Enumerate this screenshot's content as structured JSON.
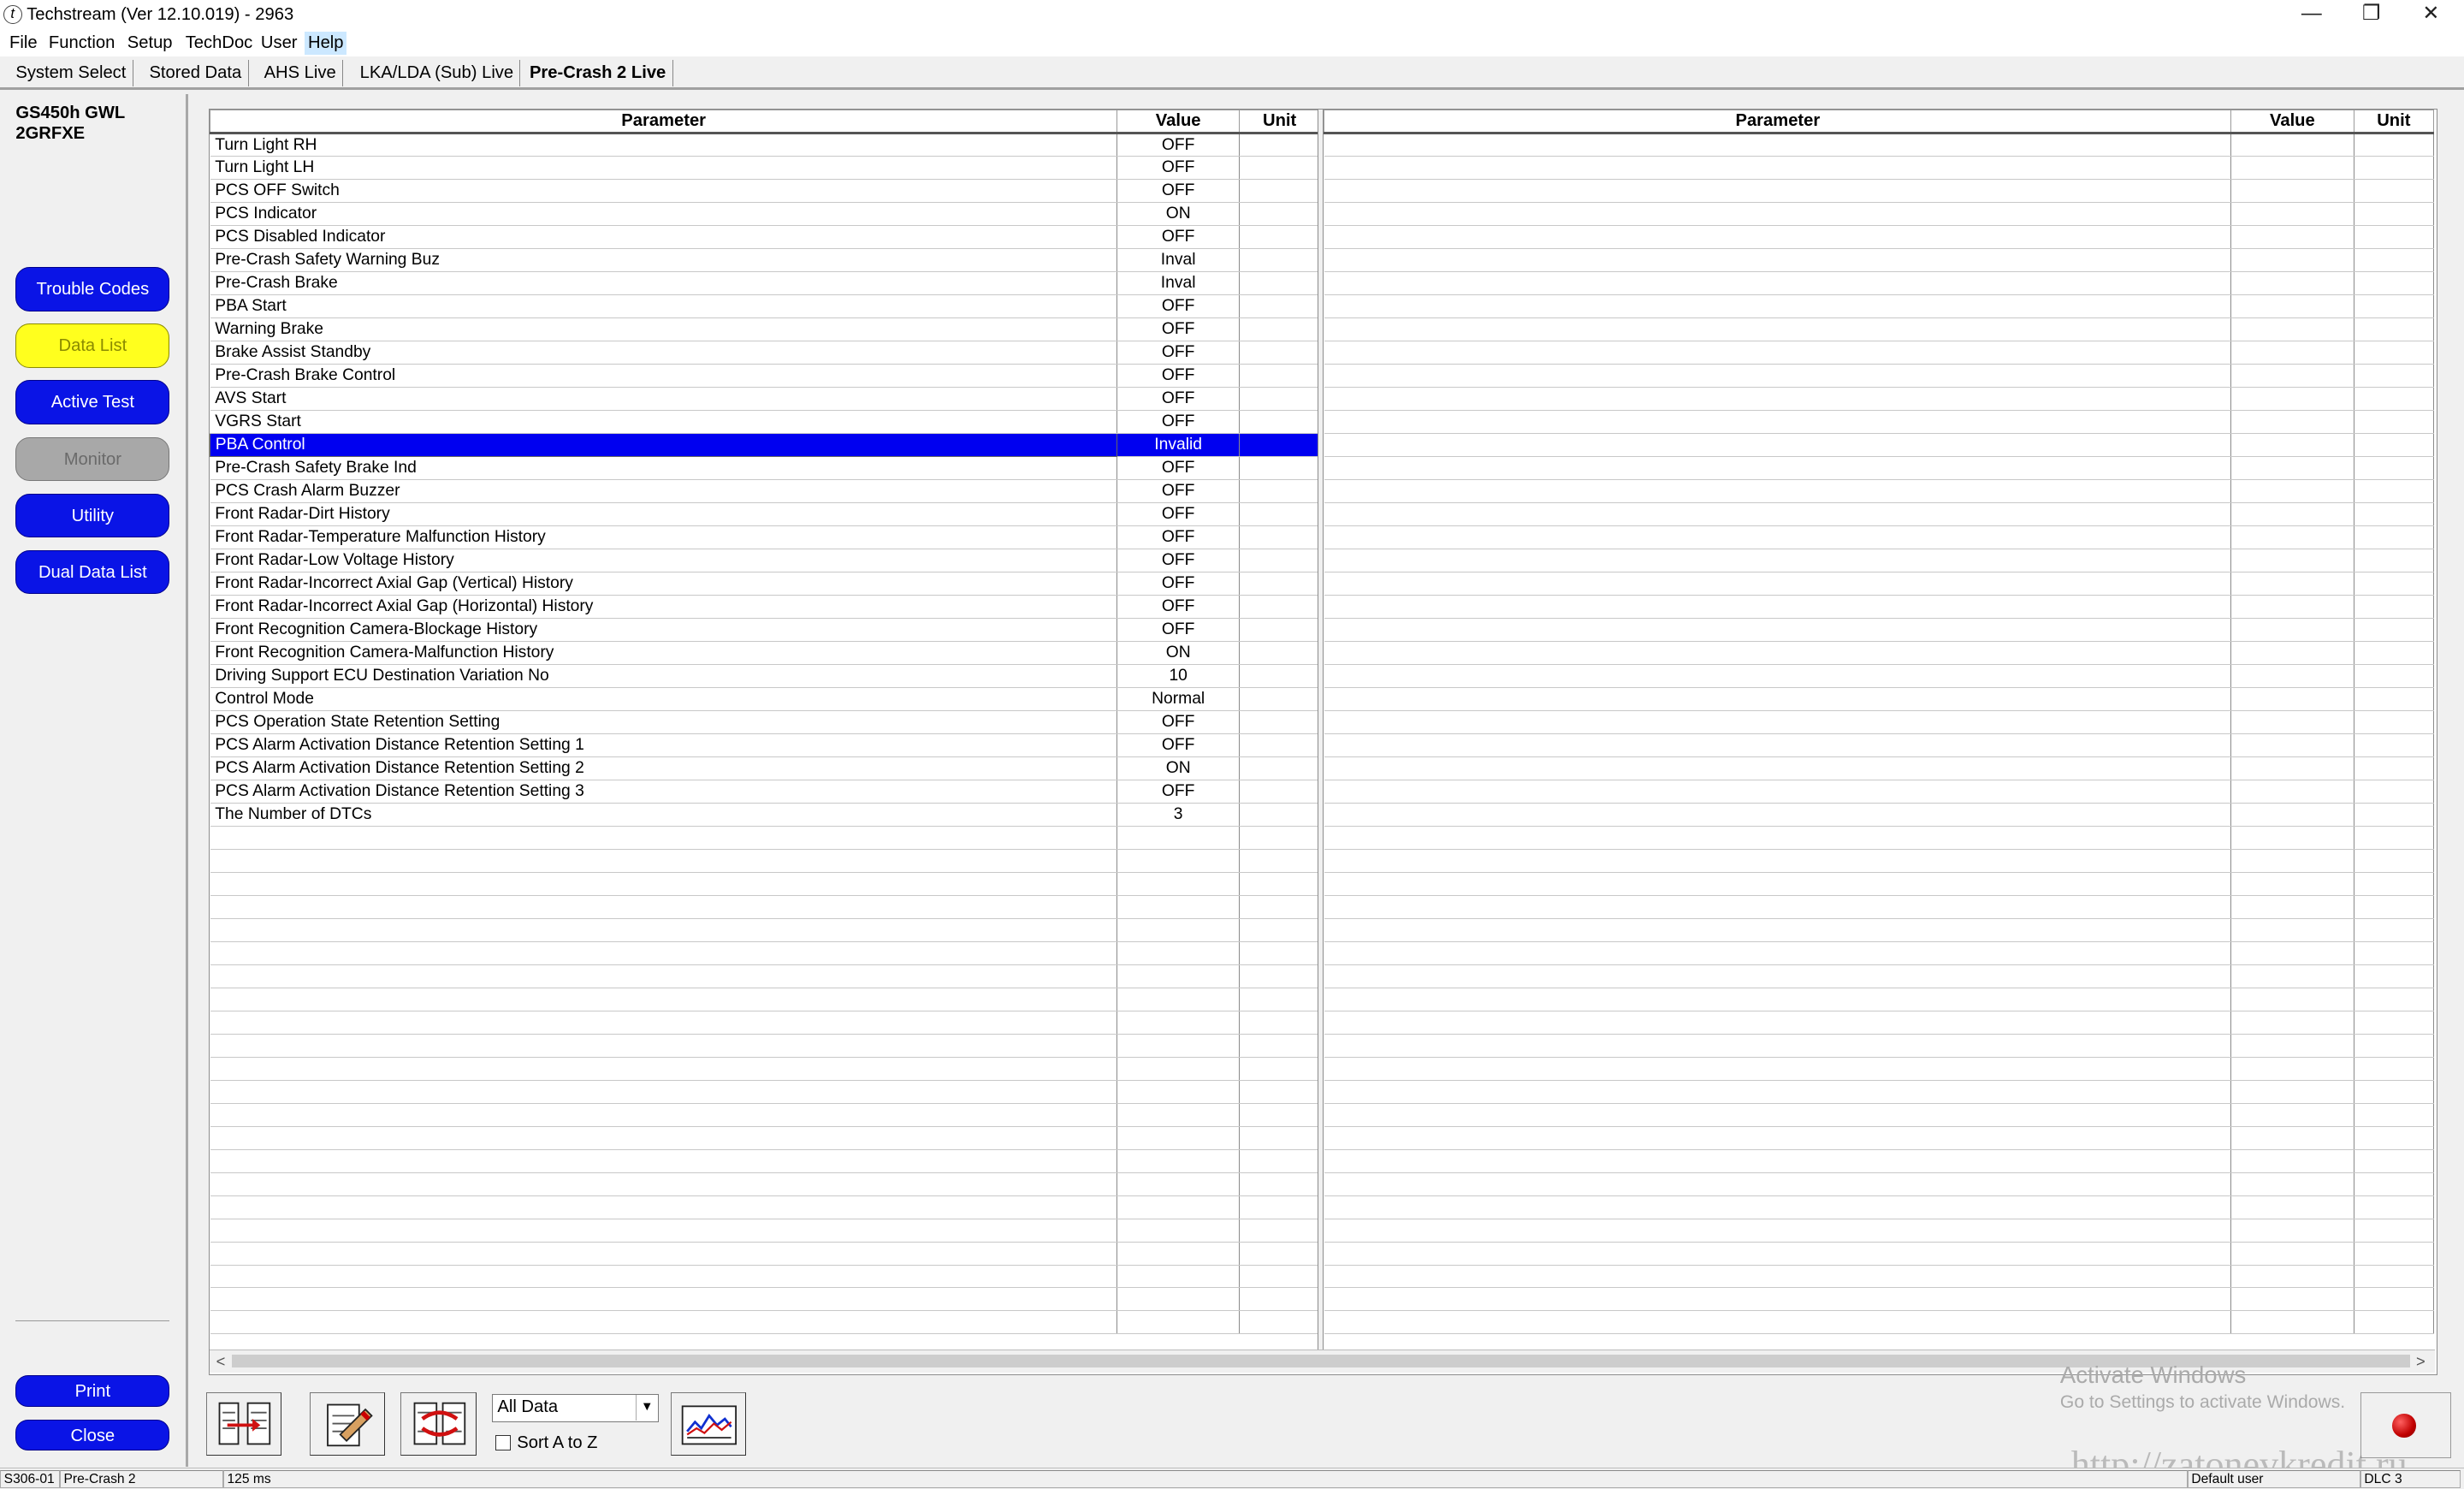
{
  "window": {
    "title": "Techstream (Ver 12.10.019) - 2963",
    "minimize": "—",
    "restore": "❐",
    "close": "✕"
  },
  "menu": [
    "File",
    "Function",
    "Setup",
    "TechDoc",
    "User",
    "Help"
  ],
  "tabs": [
    "System Select",
    "Stored Data",
    "AHS Live",
    "LKA/LDA (Sub) Live",
    "Pre-Crash 2 Live"
  ],
  "vehicle": {
    "line1": "GS450h GWL",
    "line2": "2GRFXE"
  },
  "nav": {
    "trouble_codes": "Trouble Codes",
    "data_list": "Data List",
    "active_test": "Active Test",
    "monitor": "Monitor",
    "utility": "Utility",
    "dual_data_list": "Dual Data List",
    "print": "Print",
    "close": "Close"
  },
  "table": {
    "headers": {
      "parameter": "Parameter",
      "value": "Value",
      "unit": "Unit"
    },
    "rows": [
      [
        "Turn Light RH",
        "OFF",
        ""
      ],
      [
        "Turn Light LH",
        "OFF",
        ""
      ],
      [
        "PCS OFF Switch",
        "OFF",
        ""
      ],
      [
        "PCS Indicator",
        "ON",
        ""
      ],
      [
        "PCS Disabled Indicator",
        "OFF",
        ""
      ],
      [
        "Pre-Crash Safety Warning Buz",
        "Inval",
        ""
      ],
      [
        "Pre-Crash Brake",
        "Inval",
        ""
      ],
      [
        "PBA Start",
        "OFF",
        ""
      ],
      [
        "Warning Brake",
        "OFF",
        ""
      ],
      [
        "Brake Assist Standby",
        "OFF",
        ""
      ],
      [
        "Pre-Crash Brake Control",
        "OFF",
        ""
      ],
      [
        "AVS Start",
        "OFF",
        ""
      ],
      [
        "VGRS Start",
        "OFF",
        ""
      ],
      [
        "PBA Control",
        "Invalid",
        ""
      ],
      [
        "Pre-Crash Safety Brake Ind",
        "OFF",
        ""
      ],
      [
        "PCS Crash Alarm Buzzer",
        "OFF",
        ""
      ],
      [
        "Front Radar-Dirt History",
        "OFF",
        ""
      ],
      [
        "Front Radar-Temperature Malfunction History",
        "OFF",
        ""
      ],
      [
        "Front Radar-Low Voltage History",
        "OFF",
        ""
      ],
      [
        "Front Radar-Incorrect Axial Gap (Vertical) History",
        "OFF",
        ""
      ],
      [
        "Front Radar-Incorrect Axial Gap (Horizontal) History",
        "OFF",
        ""
      ],
      [
        "Front Recognition Camera-Blockage History",
        "OFF",
        ""
      ],
      [
        "Front Recognition Camera-Malfunction History",
        "ON",
        ""
      ],
      [
        "Driving Support ECU Destination Variation No",
        "10",
        ""
      ],
      [
        "Control Mode",
        "Normal",
        ""
      ],
      [
        "PCS Operation State Retention Setting",
        "OFF",
        ""
      ],
      [
        "PCS Alarm Activation Distance Retention Setting 1",
        "OFF",
        ""
      ],
      [
        "PCS Alarm Activation Distance Retention Setting 2",
        "ON",
        ""
      ],
      [
        "PCS Alarm Activation Distance Retention Setting 3",
        "OFF",
        ""
      ],
      [
        "The Number of DTCs",
        "3",
        ""
      ]
    ],
    "selected_index": 13,
    "total_rows": 52
  },
  "toolbar": {
    "filter_selected": "All Data",
    "sort_label": "Sort A to Z",
    "sort_checked": false
  },
  "watermark": {
    "line1": "Activate Windows",
    "line2": "Go to Settings to activate Windows."
  },
  "site_watermark": "http://zatonevkredit.ru",
  "statusbar": {
    "code": "S306-01",
    "screen": "Pre-Crash 2",
    "interval": "125 ms",
    "user": "Default user",
    "connection": "DLC 3"
  },
  "colors": {
    "nav_blue": "#0a14e6",
    "nav_yellow": "#ffff1e",
    "selection": "#0000f0"
  }
}
